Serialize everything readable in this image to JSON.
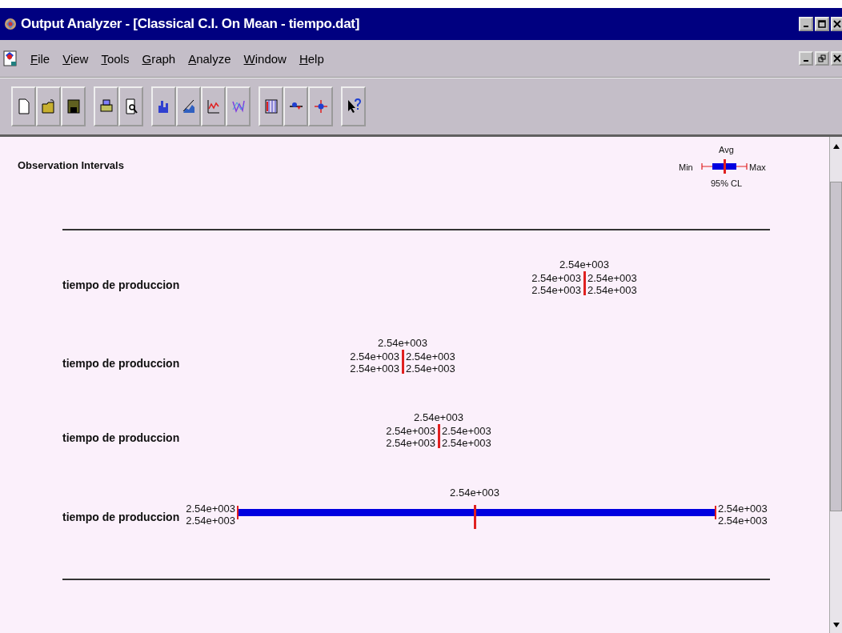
{
  "window": {
    "title": "Output Analyzer - [Classical C.I. On Mean - tiempo.dat]"
  },
  "menu": [
    "File",
    "View",
    "Tools",
    "Graph",
    "Analyze",
    "Window",
    "Help"
  ],
  "graph": {
    "title": "Observation Intervals",
    "legend": {
      "avg": "Avg",
      "min": "Min",
      "max": "Max",
      "cl": "95% CL"
    },
    "rows": [
      {
        "kind": "tick",
        "label": "tiempo de produccion",
        "avg": "2.54e+003",
        "ci_low": "2.54e+003",
        "ci_high": "2.54e+003",
        "min": "2.54e+003",
        "max": "2.54e+003"
      },
      {
        "kind": "tick",
        "label": "tiempo de produccion",
        "avg": "2.54e+003",
        "ci_low": "2.54e+003",
        "ci_high": "2.54e+003",
        "min": "2.54e+003",
        "max": "2.54e+003"
      },
      {
        "kind": "tick",
        "label": "tiempo de produccion",
        "avg": "2.54e+003",
        "ci_low": "2.54e+003",
        "ci_high": "2.54e+003",
        "min": "2.54e+003",
        "max": "2.54e+003"
      },
      {
        "kind": "bar",
        "label": "tiempo de produccion",
        "avg": "2.54e+003",
        "ci_low": "2.54e+003",
        "ci_high": "2.54e+003",
        "min": "2.54e+003",
        "max": "2.54e+003"
      }
    ]
  }
}
